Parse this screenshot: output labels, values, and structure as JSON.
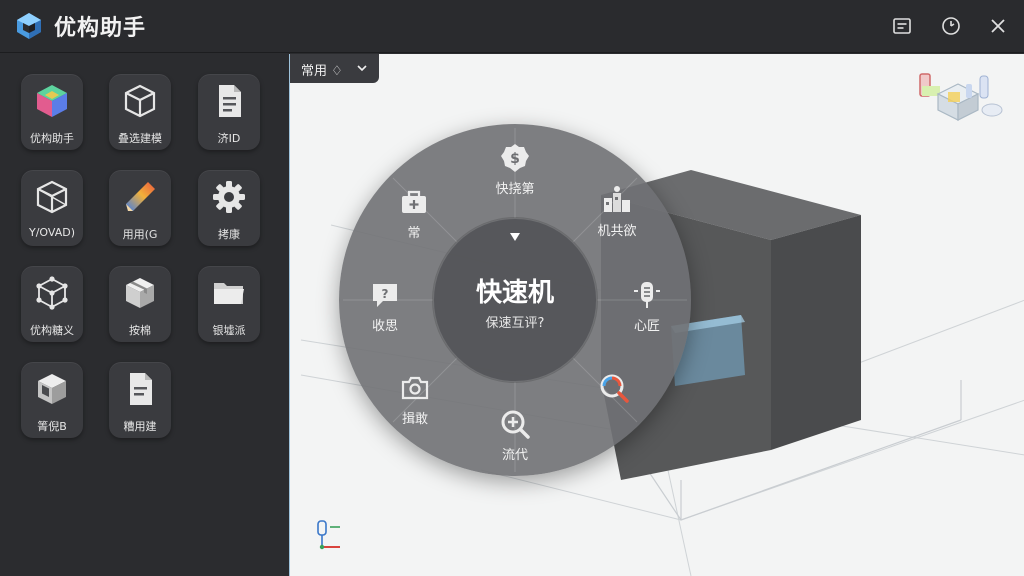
{
  "app": {
    "title": "优构助手"
  },
  "sidebar": {
    "tiles": [
      {
        "label": "优构助手",
        "icon": "colorful-cube-icon"
      },
      {
        "label": "叠选建模",
        "icon": "wire-cube-icon"
      },
      {
        "label": "济ID",
        "icon": "document-icon"
      },
      {
        "label": "Y/OVAD)",
        "icon": "outline-cube-icon"
      },
      {
        "label": "用用(G",
        "icon": "pencil-icon"
      },
      {
        "label": "拷康",
        "icon": "gear-icon"
      },
      {
        "label": "优构糖义",
        "icon": "node-cube-icon"
      },
      {
        "label": "按棉",
        "icon": "package-icon"
      },
      {
        "label": "银墟派",
        "icon": "folder-icon"
      },
      {
        "label": "箐倪B",
        "icon": "box-cube-icon"
      },
      {
        "label": "糟用建",
        "icon": "file-icon"
      }
    ]
  },
  "viewport": {
    "dropdown": {
      "label": "常用 ♢"
    }
  },
  "radial_menu": {
    "center_title": "快速机",
    "center_subtitle": "保速互评?",
    "items": [
      {
        "label": "快挠第",
        "icon": "dollar-badge-icon"
      },
      {
        "label": "机共欲",
        "icon": "structure-icon"
      },
      {
        "label": "心匠",
        "icon": "microphone-icon"
      },
      {
        "label": "",
        "icon": "color-search-icon"
      },
      {
        "label": "流代",
        "icon": "zoom-in-icon"
      },
      {
        "label": "揖敢",
        "icon": "camera-icon"
      },
      {
        "label": "收思",
        "icon": "chat-icon"
      },
      {
        "label": "常",
        "icon": "toolbox-icon"
      }
    ]
  },
  "colors": {
    "titlebar": "#2a2b2e",
    "sidebar": "#2b2c2f",
    "tile": "#3a3b3f",
    "viewport": "#f3f4f4",
    "radial": "#707174",
    "box": "#545557",
    "accent": "#9fc3dc"
  }
}
